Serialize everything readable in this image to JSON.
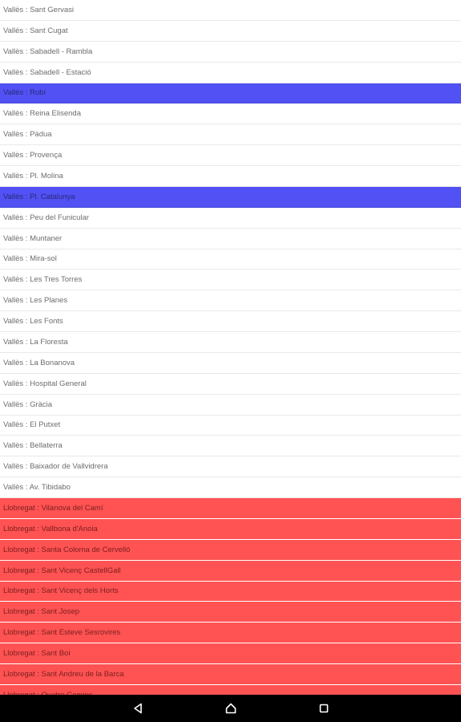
{
  "stations": [
    {
      "label": "Vallès : Sant Gervasi",
      "state": "normal"
    },
    {
      "label": "Vallès : Sant Cugat",
      "state": "normal"
    },
    {
      "label": "Vallès : Sabadell - Rambla",
      "state": "normal"
    },
    {
      "label": "Vallès : Sabadell - Estació",
      "state": "normal"
    },
    {
      "label": "Vallès : Rubí",
      "state": "selected"
    },
    {
      "label": "Vallès : Reina Elisenda",
      "state": "normal"
    },
    {
      "label": "Vallès : Pàdua",
      "state": "normal"
    },
    {
      "label": "Vallès : Provença",
      "state": "normal"
    },
    {
      "label": "Vallès : Pl. Molina",
      "state": "normal"
    },
    {
      "label": "Vallès : Pl. Catalunya",
      "state": "selected"
    },
    {
      "label": "Vallès : Peu del Funicular",
      "state": "normal"
    },
    {
      "label": "Vallès : Muntaner",
      "state": "normal"
    },
    {
      "label": "Vallès : Mira-sol",
      "state": "normal"
    },
    {
      "label": "Vallès : Les Tres Torres",
      "state": "normal"
    },
    {
      "label": "Vallès : Les Planes",
      "state": "normal"
    },
    {
      "label": "Vallès : Les Fonts",
      "state": "normal"
    },
    {
      "label": "Vallès : La Floresta",
      "state": "normal"
    },
    {
      "label": "Vallès : La Bonanova",
      "state": "normal"
    },
    {
      "label": "Vallès : Hospital General",
      "state": "normal"
    },
    {
      "label": "Vallès : Gràcia",
      "state": "normal"
    },
    {
      "label": "Vallès : El Putxet",
      "state": "normal"
    },
    {
      "label": "Vallès : Bellaterra",
      "state": "normal"
    },
    {
      "label": "Vallès : Baixador de Vallvidrera",
      "state": "normal"
    },
    {
      "label": "Vallès : Av. Tibidabo",
      "state": "normal"
    },
    {
      "label": "Llobregat : Vilanova del Camí",
      "state": "llobregat"
    },
    {
      "label": "Llobregat : Vallbona d'Anoia",
      "state": "llobregat"
    },
    {
      "label": "Llobregat : Santa Coloma de Cervelló",
      "state": "llobregat"
    },
    {
      "label": "Llobregat : Sant Vicenç CastellGall",
      "state": "llobregat"
    },
    {
      "label": "Llobregat : Sant Vicenç dels Horts",
      "state": "llobregat"
    },
    {
      "label": "Llobregat : Sant Josep",
      "state": "llobregat"
    },
    {
      "label": "Llobregat : Sant Esteve Sesrovires",
      "state": "llobregat"
    },
    {
      "label": "Llobregat : Sant Boi",
      "state": "llobregat"
    },
    {
      "label": "Llobregat : Sant Andreu de la Barca",
      "state": "llobregat"
    },
    {
      "label": "Llobregat : Quatre Camins",
      "state": "llobregat"
    }
  ],
  "colors": {
    "selected": "#5151f4",
    "llobregat": "#ff5252",
    "navbar": "#000000"
  },
  "navbar": {
    "icons": [
      "back-icon",
      "home-icon",
      "recents-icon"
    ]
  }
}
